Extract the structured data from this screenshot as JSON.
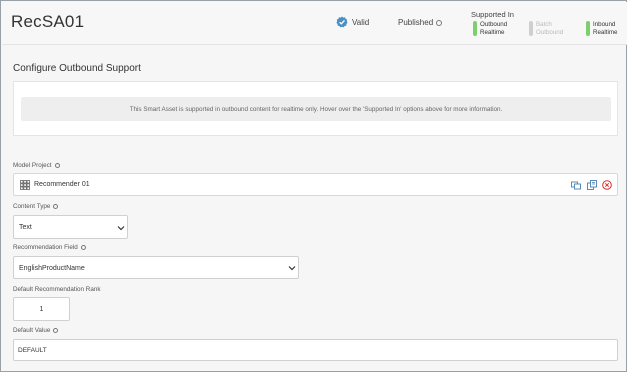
{
  "header": {
    "title": "RecSA01",
    "valid_label": "Valid",
    "published_label": "Published",
    "supported_in_label": "Supported In",
    "supported_items": [
      {
        "line1": "Outbound",
        "line2": "Realtime",
        "enabled": true,
        "color": "#7ccf6c"
      },
      {
        "line1": "Batch",
        "line2": "Outbound",
        "enabled": false,
        "color": "#cfcfcf"
      },
      {
        "line1": "Inbound",
        "line2": "Realtime",
        "enabled": true,
        "color": "#7ccf6c"
      }
    ]
  },
  "section": {
    "title": "Configure Outbound Support",
    "notice": "This Smart Asset is supported in outbound content for realtime only. Hover over the 'Supported In' options above for more information."
  },
  "form": {
    "model_project": {
      "label": "Model Project",
      "value": "Recommender 01"
    },
    "content_type": {
      "label": "Content Type",
      "value": "Text"
    },
    "recommendation_field": {
      "label": "Recommendation Field",
      "value": "EnglishProductName"
    },
    "default_rank": {
      "label": "Default Recommendation Rank",
      "value": "1"
    },
    "default_value": {
      "label": "Default Value",
      "value": "DEFAULT"
    }
  },
  "colors": {
    "valid_badge": "#4a90c2",
    "delete_icon": "#d0312d",
    "action_icons": "#4a7fb0"
  },
  "icons": {
    "valid": "check-badge-icon",
    "info": "info-icon",
    "model": "grid-model-icon",
    "link": "link-icon",
    "copy": "copy-icon",
    "remove": "remove-circle-icon",
    "dropdown": "chevron-down-icon"
  }
}
